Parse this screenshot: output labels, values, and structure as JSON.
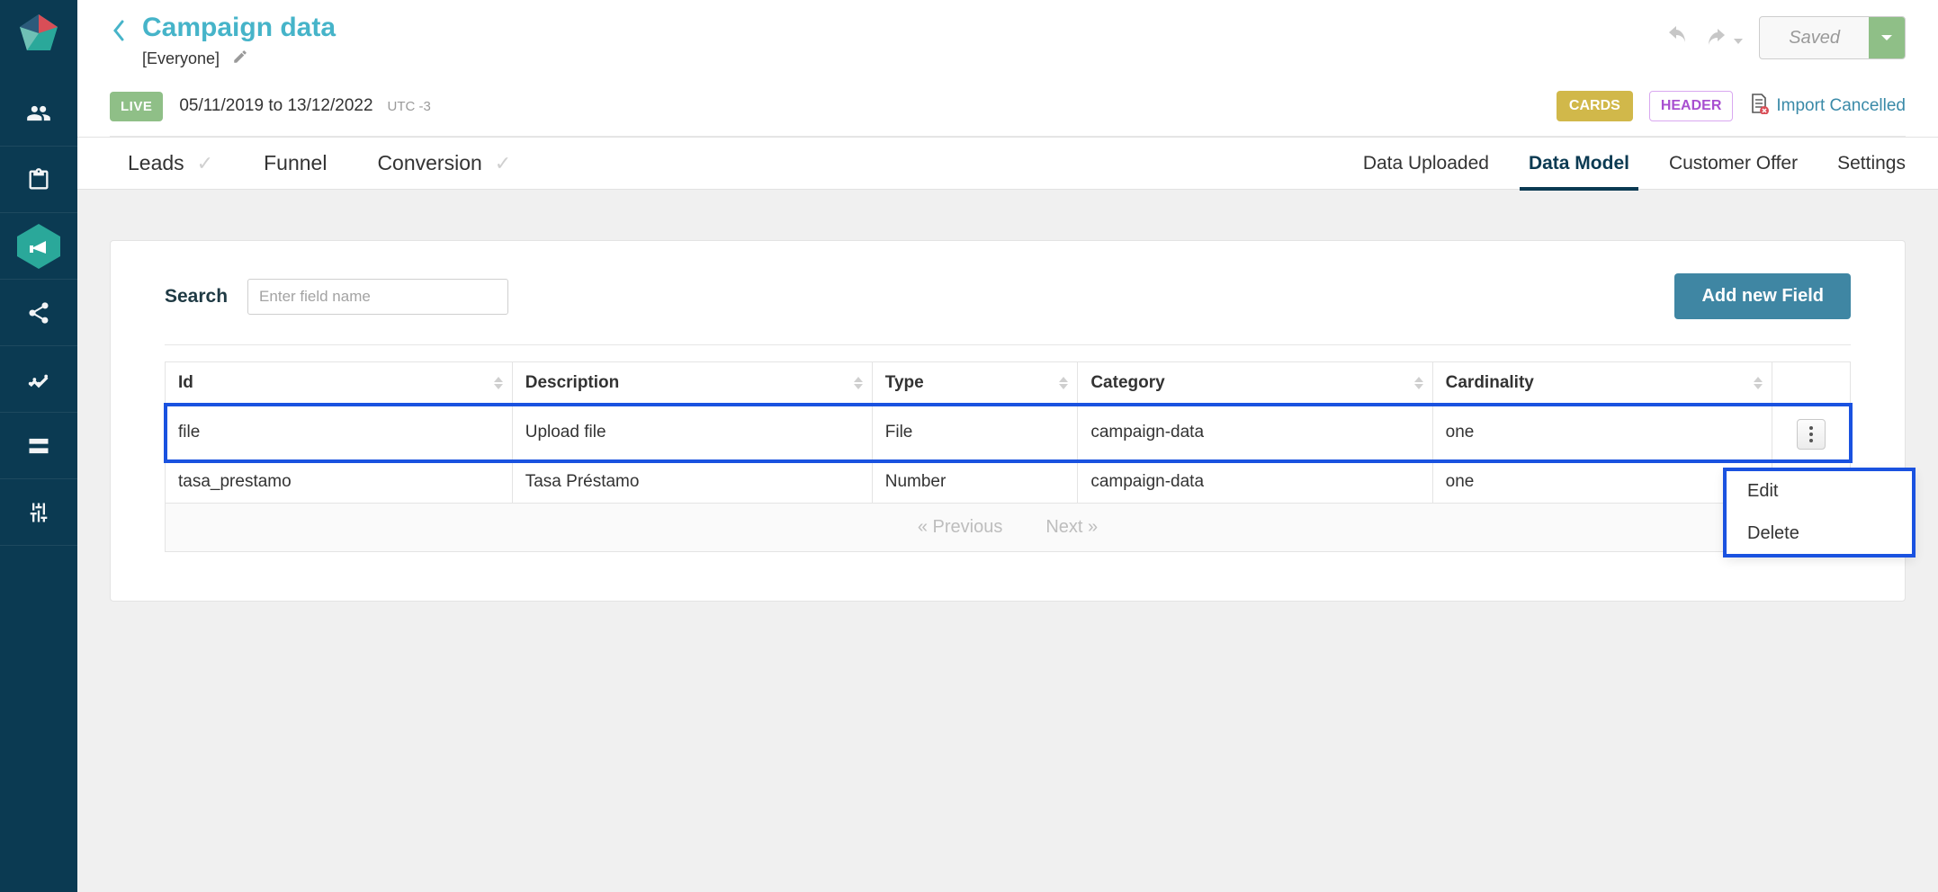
{
  "header": {
    "title": "Campaign data",
    "audience": "[Everyone]",
    "saved_label": "Saved",
    "live_badge": "LIVE",
    "date_from": "05/11/2019",
    "date_to_label": "to",
    "date_to": "13/12/2022",
    "timezone": "UTC -3",
    "cards_badge": "CARDS",
    "header_badge": "HEADER",
    "import_cancelled": "Import Cancelled"
  },
  "left_tabs": [
    "Leads",
    "Funnel",
    "Conversion"
  ],
  "right_tabs": [
    "Data Uploaded",
    "Data Model",
    "Customer Offer",
    "Settings"
  ],
  "active_right_tab": "Data Model",
  "search": {
    "label": "Search",
    "placeholder": "Enter field name"
  },
  "add_button": "Add new Field",
  "columns": [
    "Id",
    "Description",
    "Type",
    "Category",
    "Cardinality"
  ],
  "rows": [
    {
      "id": "file",
      "description": "Upload file",
      "type": "File",
      "category": "campaign-data",
      "cardinality": "one"
    },
    {
      "id": "tasa_prestamo",
      "description": "Tasa Préstamo",
      "type": "Number",
      "category": "campaign-data",
      "cardinality": "one"
    }
  ],
  "pager": {
    "prev": "« Previous",
    "next": "Next »"
  },
  "dropdown": {
    "edit": "Edit",
    "delete": "Delete"
  }
}
